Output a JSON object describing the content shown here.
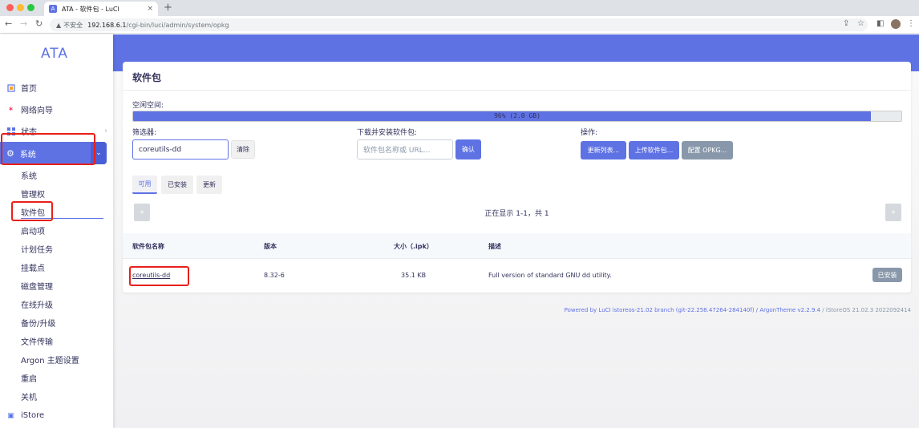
{
  "browser": {
    "tab_title": "ATA - 软件包 - LuCI",
    "tab_close": "×",
    "new_tab": "+",
    "insecure_label": "不安全",
    "url_host": "192.168.6.1",
    "url_path": "/cgi-bin/luci/admin/system/opkg"
  },
  "sidebar": {
    "brand": "ATA",
    "items": [
      {
        "label": "首页",
        "icon": "home-icon"
      },
      {
        "label": "网络向导",
        "icon": "wizard-icon"
      },
      {
        "label": "状态",
        "icon": "status-icon"
      },
      {
        "label": "系统",
        "icon": "gear-icon"
      }
    ],
    "sub_items": [
      "系统",
      "管理权",
      "软件包",
      "启动项",
      "计划任务",
      "挂载点",
      "磁盘管理",
      "在线升级",
      "备份/升级",
      "文件传输",
      "Argon 主题设置",
      "重启",
      "关机"
    ],
    "bottom_item": {
      "label": "iStore",
      "icon": "store-icon"
    }
  },
  "page": {
    "title": "软件包",
    "free_space_label": "空闲空间:",
    "free_space_percent": 96,
    "free_space_text": "96% (2.0 GB)",
    "filter_label": "筛选器:",
    "filter_value": "coreutils-dd",
    "clear_label": "清除",
    "download_label": "下载并安装软件包:",
    "download_placeholder": "软件包名称或 URL...",
    "confirm_label": "确认",
    "actions_label": "操作:",
    "update_lists_label": "更新列表...",
    "upload_label": "上传软件包...",
    "config_label": "配置 OPKG...",
    "tabs": [
      "可用",
      "已安装",
      "更新"
    ],
    "pager_prev": "«",
    "pager_next": "»",
    "pager_text": "正在显示 1-1，共 1",
    "table": {
      "headers": [
        "软件包名称",
        "版本",
        "大小（.ipk）",
        "描述"
      ],
      "rows": [
        {
          "name": "coreutils-dd",
          "version": "8.32-6",
          "size": "35.1 KB",
          "description": "Full version of standard GNU dd utility.",
          "action": "已安装"
        }
      ]
    }
  },
  "footer": {
    "powered": "Powered by LuCI istoreos-21.02 branch (git-22.258.47264-284140f) / ArgonTheme v2.2.9.4",
    "os": " / iStoreOS 21.02.3 2022092414"
  },
  "colors": {
    "accent": "#5e72e4",
    "highlight": "#e8201a"
  }
}
